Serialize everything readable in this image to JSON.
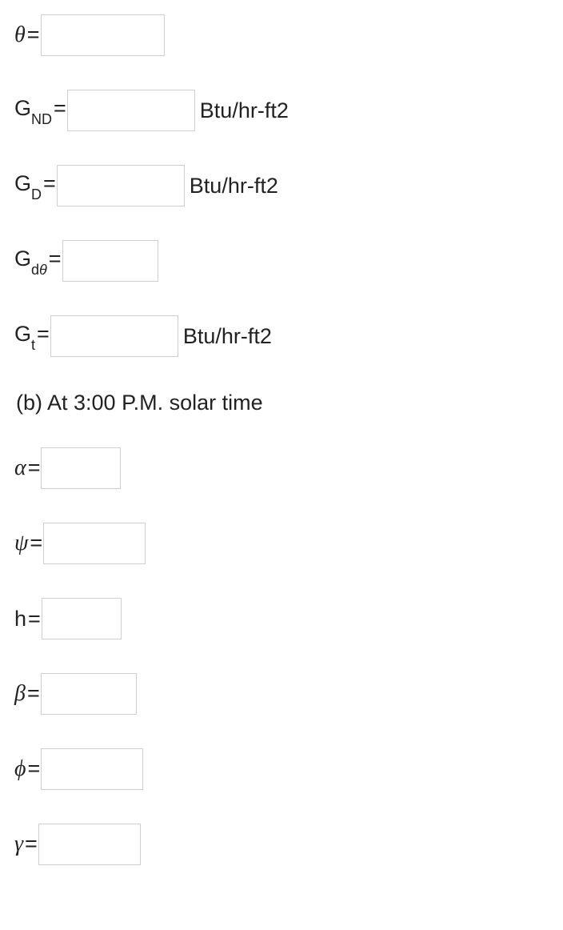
{
  "fields": {
    "theta": {
      "label_main": "θ",
      "label_sub": "",
      "eq": "=",
      "value": "",
      "unit": ""
    },
    "gnd": {
      "label_main": "G",
      "label_sub": "ND",
      "eq": "=",
      "value": "",
      "unit": "Btu/hr-ft2"
    },
    "gd": {
      "label_main": "G",
      "label_sub": "D",
      "eq": "=",
      "value": "",
      "unit": "Btu/hr-ft2"
    },
    "gdth": {
      "label_main": "G",
      "label_sub": "d",
      "label_sub_sym": "θ",
      "eq": "=",
      "value": "",
      "unit": ""
    },
    "gt": {
      "label_main": "G",
      "label_sub": "t",
      "eq": "=",
      "value": "",
      "unit": "Btu/hr-ft2"
    },
    "heading_b": "(b) At 3:00 P.M. solar time",
    "alpha": {
      "label_main": "α",
      "eq": "=",
      "value": "",
      "unit": ""
    },
    "psi": {
      "label_main": "ψ",
      "eq": "=",
      "value": "",
      "unit": ""
    },
    "h": {
      "label_main": "h",
      "eq": "=",
      "value": "",
      "unit": ""
    },
    "beta": {
      "label_main": "β",
      "eq": "=",
      "value": "",
      "unit": ""
    },
    "phi": {
      "label_main": "ϕ",
      "eq": "=",
      "value": "",
      "unit": ""
    },
    "gamma": {
      "label_main": "γ",
      "eq": "=",
      "value": "",
      "unit": ""
    }
  }
}
